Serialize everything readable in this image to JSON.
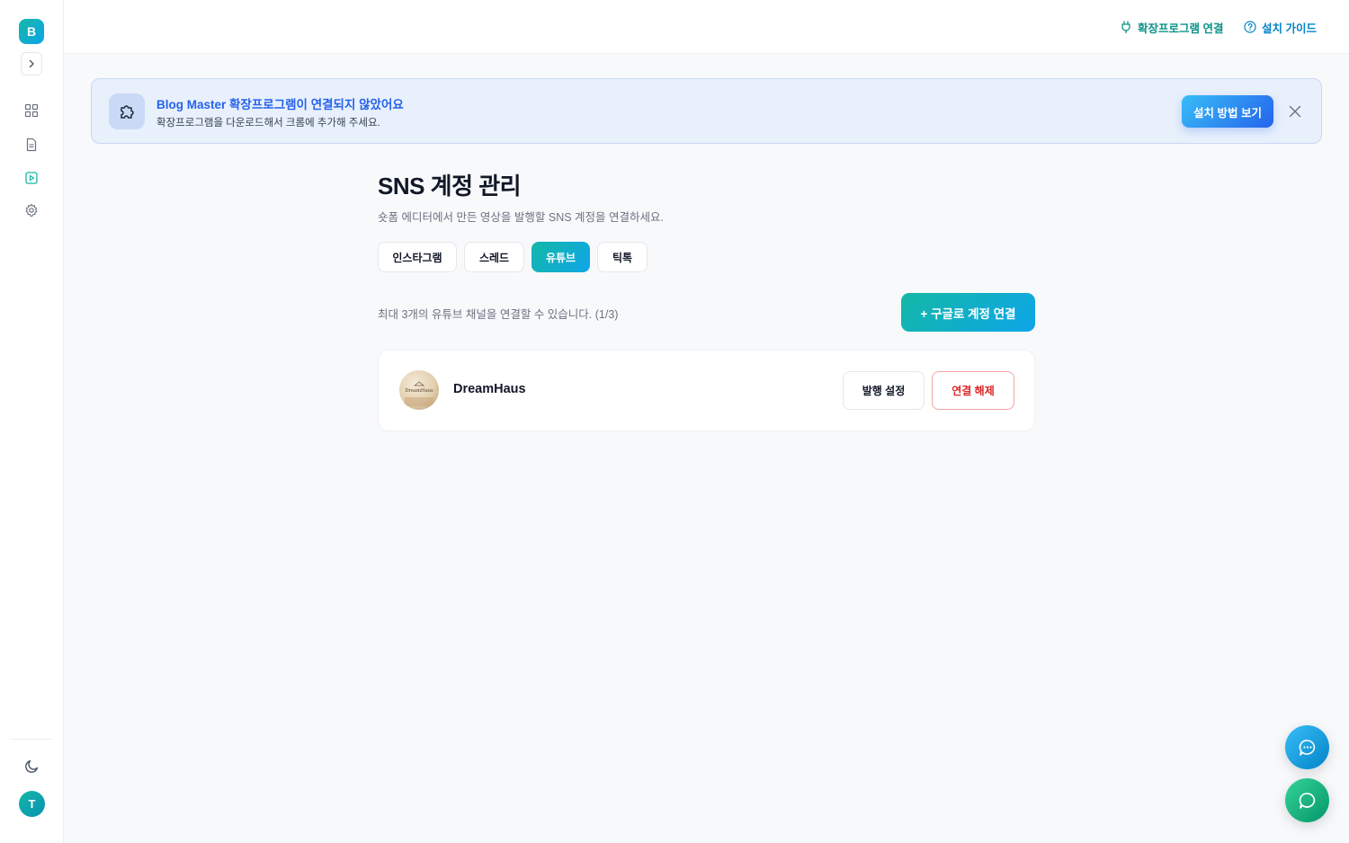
{
  "sidebar": {
    "logo_letter": "B",
    "expand_icon": "chevron-right-icon",
    "nav_items": [
      {
        "icon": "grid-icon",
        "active": false
      },
      {
        "icon": "document-icon",
        "active": false
      },
      {
        "icon": "play-icon",
        "active": true
      },
      {
        "icon": "gear-icon",
        "active": false
      }
    ],
    "theme_icon": "moon-icon",
    "avatar_letter": "T"
  },
  "topbar": {
    "extension_link": "확장프로그램 연결",
    "guide_link": "설치 가이드"
  },
  "banner": {
    "title": "Blog Master 확장프로그램이 연결되지 않았어요",
    "description": "확장프로그램을 다운로드해서 크롬에 추가해 주세요.",
    "button_label": "설치 방법 보기"
  },
  "main": {
    "title": "SNS 계정 관리",
    "subtitle": "숏폼 에디터에서 만든 영상을 발행할 SNS 계정을 연결하세요.",
    "tabs": [
      {
        "label": "인스타그램",
        "active": false
      },
      {
        "label": "스레드",
        "active": false
      },
      {
        "label": "유튜브",
        "active": true
      },
      {
        "label": "틱톡",
        "active": false
      }
    ],
    "limit_text": "최대 3개의 유튜브 채널을 연결할 수 있습니다. (1/3)",
    "connect_button": "+ 구글로 계정 연결",
    "accounts": [
      {
        "name": "DreamHaus",
        "avatar_text": "DreamHaus",
        "settings_button": "발행 설정",
        "disconnect_button": "연결 해제"
      }
    ]
  },
  "colors": {
    "accent_teal": "#14b8a6",
    "accent_blue": "#2563eb",
    "danger": "#dc2626"
  }
}
